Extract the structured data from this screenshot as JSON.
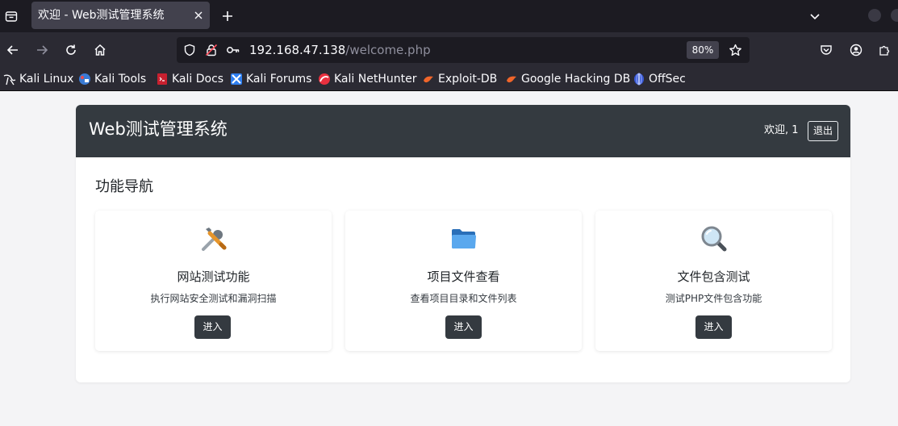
{
  "browser": {
    "tab": {
      "title": "欢迎 - Web测试管理系统"
    },
    "url": {
      "host": "192.168.47.138",
      "path": "/welcome.php"
    },
    "zoom": "80%",
    "bookmarks": [
      {
        "label": "Kali Linux",
        "icon": "kali-dragon-icon"
      },
      {
        "label": "Kali Tools",
        "icon": "kali-tools-icon"
      },
      {
        "label": "Kali Docs",
        "icon": "kali-docs-icon"
      },
      {
        "label": "Kali Forums",
        "icon": "kali-forums-icon"
      },
      {
        "label": "Kali NetHunter",
        "icon": "nethunter-icon"
      },
      {
        "label": "Exploit-DB",
        "icon": "exploit-db-icon"
      },
      {
        "label": "Google Hacking DB",
        "icon": "ghdb-icon"
      },
      {
        "label": "OffSec",
        "icon": "offsec-icon"
      }
    ]
  },
  "page": {
    "app_title": "Web测试管理系统",
    "welcome": "欢迎, 1",
    "logout_label": "退出",
    "section_title": "功能导航",
    "features": [
      {
        "icon": "tools-icon",
        "title": "网站测试功能",
        "desc": "执行网站安全测试和漏洞扫描",
        "button": "进入"
      },
      {
        "icon": "folder-icon",
        "title": "项目文件查看",
        "desc": "查看项目目录和文件列表",
        "button": "进入"
      },
      {
        "icon": "magnifier-icon",
        "title": "文件包含测试",
        "desc": "测试PHP文件包含功能",
        "button": "进入"
      }
    ]
  },
  "colors": {
    "header_bg": "#343a40",
    "button_bg": "#343a40",
    "page_bg": "#f4f4f6",
    "browser_dark": "#1c1b22",
    "toolbar": "#2b2a33"
  }
}
